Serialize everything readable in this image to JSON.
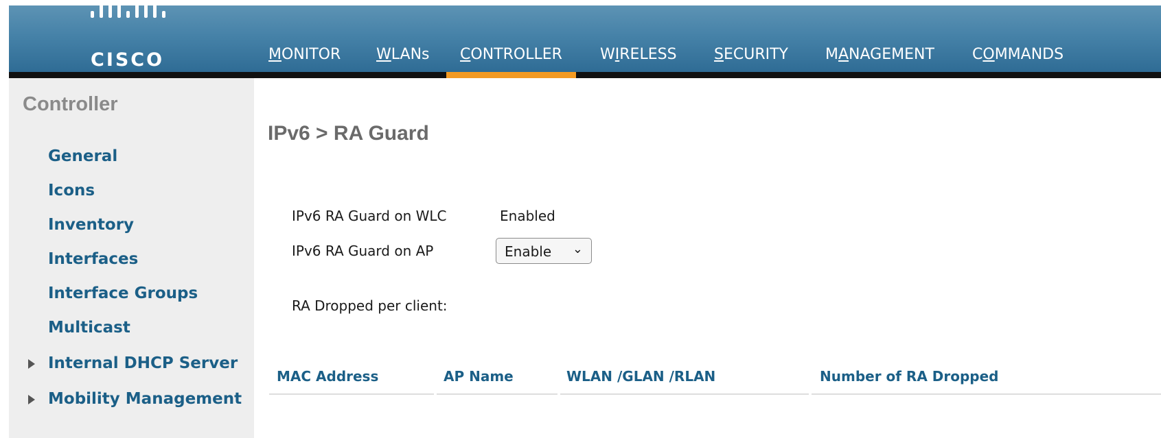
{
  "brand": {
    "name": "CISCO",
    "logo_icon": "cisco-bridge-icon"
  },
  "nav": {
    "items": [
      {
        "label": "MONITOR",
        "accel": "M"
      },
      {
        "label": "WLANs",
        "accel": "W"
      },
      {
        "label": "CONTROLLER",
        "accel": "C",
        "active": true
      },
      {
        "label": "WIRELESS",
        "accel": "I"
      },
      {
        "label": "SECURITY",
        "accel": "S"
      },
      {
        "label": "MANAGEMENT",
        "accel": "A"
      },
      {
        "label": "COMMANDS",
        "accel": "O"
      }
    ]
  },
  "sidebar": {
    "title": "Controller",
    "items": [
      {
        "label": "General"
      },
      {
        "label": "Icons"
      },
      {
        "label": "Inventory"
      },
      {
        "label": "Interfaces"
      },
      {
        "label": "Interface Groups"
      },
      {
        "label": "Multicast"
      },
      {
        "label": "Internal DHCP Server",
        "expandable": true
      },
      {
        "label": "Mobility Management",
        "expandable": true
      }
    ]
  },
  "main": {
    "title": "IPv6 > RA Guard",
    "wlc_label": "IPv6 RA Guard on WLC",
    "wlc_value": "Enabled",
    "ap_label": "IPv6 RA Guard on AP",
    "ap_select": {
      "value": "Enable"
    },
    "dropped_label": "RA Dropped per client:",
    "table": {
      "columns": [
        "MAC Address",
        "AP Name",
        "WLAN /GLAN /RLAN",
        "Number of RA Dropped"
      ]
    }
  },
  "colors": {
    "header": "#4682a8",
    "accent": "#f39a22",
    "link": "#1b5f87",
    "sidebar_bg": "#eeeeee"
  }
}
